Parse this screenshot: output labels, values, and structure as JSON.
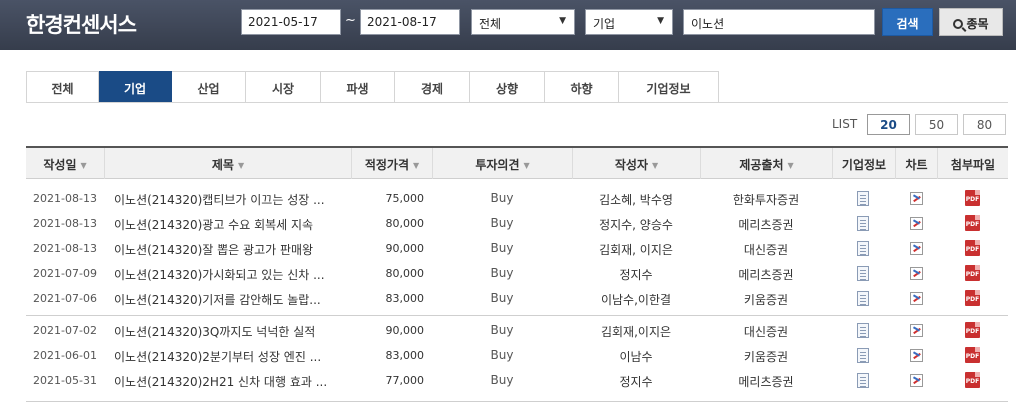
{
  "header": {
    "logo": "한경컨센서스",
    "date_from": "2021-05-17",
    "date_sep": "~",
    "date_to": "2021-08-17",
    "filter_all": "전체",
    "filter_type": "기업",
    "search_value": "이노션",
    "search_button": "검색",
    "stock_button": "종목"
  },
  "tabs": [
    {
      "label": "전체",
      "active": false
    },
    {
      "label": "기업",
      "active": true
    },
    {
      "label": "산업",
      "active": false
    },
    {
      "label": "시장",
      "active": false
    },
    {
      "label": "파생",
      "active": false
    },
    {
      "label": "경제",
      "active": false
    },
    {
      "label": "상향",
      "active": false
    },
    {
      "label": "하향",
      "active": false
    },
    {
      "label": "기업정보",
      "active": false
    }
  ],
  "list": {
    "label": "LIST",
    "options": [
      "20",
      "50",
      "80"
    ],
    "selected": "20"
  },
  "table": {
    "columns": [
      "작성일",
      "제목",
      "적정가격",
      "투자의견",
      "작성자",
      "제공출처",
      "기업정보",
      "차트",
      "첨부파일"
    ],
    "rows": [
      {
        "date": "2021-08-13",
        "title": "이노션(214320)캡티브가 이끄는 성장 ...",
        "price": "75,000",
        "opinion": "Buy",
        "author": "김소혜, 박수영",
        "source": "한화투자증권"
      },
      {
        "date": "2021-08-13",
        "title": "이노션(214320)광고 수요 회복세 지속",
        "price": "80,000",
        "opinion": "Buy",
        "author": "정지수, 양승수",
        "source": "메리츠증권"
      },
      {
        "date": "2021-08-13",
        "title": "이노션(214320)잘 뽑은 광고가 판매왕",
        "price": "90,000",
        "opinion": "Buy",
        "author": "김회재, 이지은",
        "source": "대신증권"
      },
      {
        "date": "2021-07-09",
        "title": "이노션(214320)가시화되고 있는 신차 ...",
        "price": "80,000",
        "opinion": "Buy",
        "author": "정지수",
        "source": "메리츠증권"
      },
      {
        "date": "2021-07-06",
        "title": "이노션(214320)기저를 감안해도 놀랍...",
        "price": "83,000",
        "opinion": "Buy",
        "author": "이남수,이한결",
        "source": "키움증권"
      },
      {
        "date": "2021-07-02",
        "title": "이노션(214320)3Q까지도 넉넉한 실적",
        "price": "90,000",
        "opinion": "Buy",
        "author": "김회재,이지은",
        "source": "대신증권"
      },
      {
        "date": "2021-06-01",
        "title": "이노션(214320)2분기부터 성장 엔진 ...",
        "price": "83,000",
        "opinion": "Buy",
        "author": "이남수",
        "source": "키움증권"
      },
      {
        "date": "2021-05-31",
        "title": "이노션(214320)2H21 신차 대행 효과 ...",
        "price": "77,000",
        "opinion": "Buy",
        "author": "정지수",
        "source": "메리츠증권"
      }
    ],
    "pdf_label": "PDF"
  }
}
